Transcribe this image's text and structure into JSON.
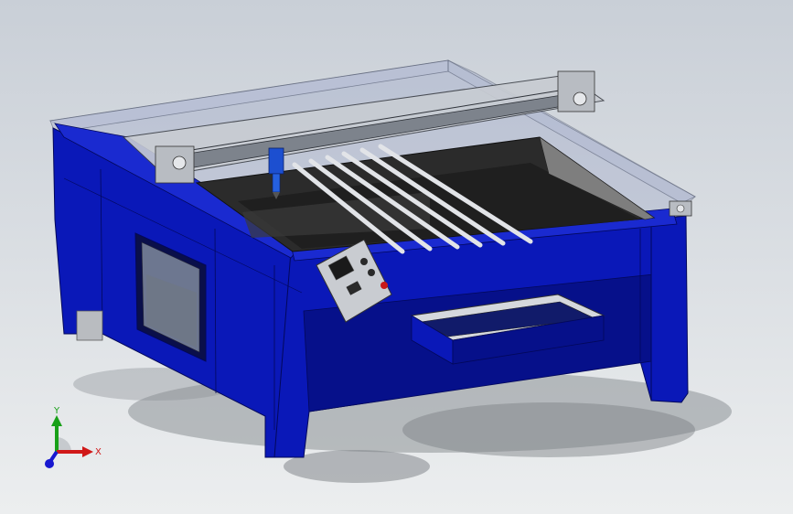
{
  "viewport": {
    "background_top": "#c9cfd7",
    "background_bottom": "#eceeef"
  },
  "model": {
    "body_color": "#0a18b8",
    "body_dark": "#06108a",
    "glass_color": "#9aa6c8",
    "metal_color": "#c8ccd2",
    "bed_color": "#2b2b2b",
    "button_color": "#c81818"
  },
  "triad": {
    "x_label": "X",
    "y_label": "Y",
    "x_color": "#d01818",
    "y_color": "#18a018",
    "z_color": "#1818d0"
  }
}
